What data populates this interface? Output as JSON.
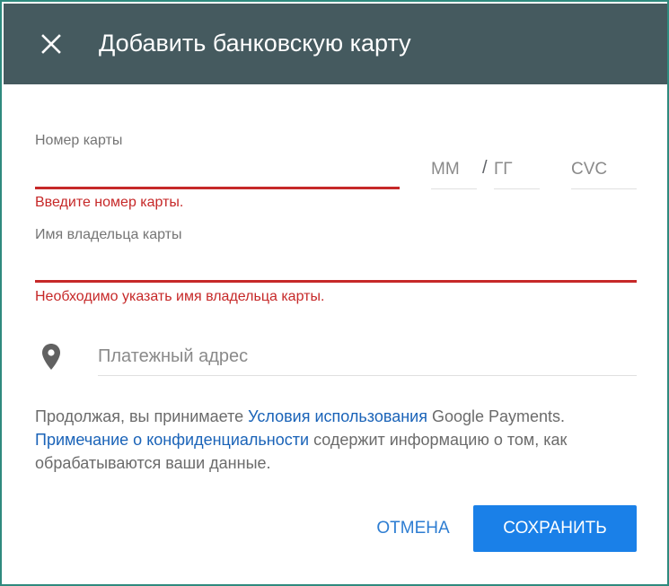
{
  "dialog": {
    "title": "Добавить банковскую карту",
    "close_icon": "close-icon"
  },
  "card_number": {
    "label": "Номер карты",
    "value": "",
    "error": "Введите номер карты."
  },
  "expiry_month": {
    "placeholder": "ММ",
    "value": ""
  },
  "expiry_separator": "/",
  "expiry_year": {
    "placeholder": "ГГ",
    "value": ""
  },
  "cvc": {
    "placeholder": "CVC",
    "value": ""
  },
  "cardholder_name": {
    "label": "Имя владельца карты",
    "value": "",
    "error": "Необходимо указать имя владельца карты."
  },
  "billing_address": {
    "placeholder": "Платежный адрес",
    "value": "",
    "icon": "location-pin-icon"
  },
  "terms": {
    "part1": "Продолжая, вы принимаете ",
    "terms_link": "Условия использования",
    "part2": " Google Payments.",
    "privacy_link": "Примечание о конфиденциальности",
    "part3": " содержит информацию о том, как обрабатываются ваши данные."
  },
  "actions": {
    "cancel_label": "ОТМЕНА",
    "save_label": "СОХРАНИТЬ"
  },
  "colors": {
    "header_bg": "#455a5f",
    "error": "#c62828",
    "link": "#1a63b8",
    "primary_button": "#1a80e8",
    "frame_border": "#2f8a7e"
  }
}
